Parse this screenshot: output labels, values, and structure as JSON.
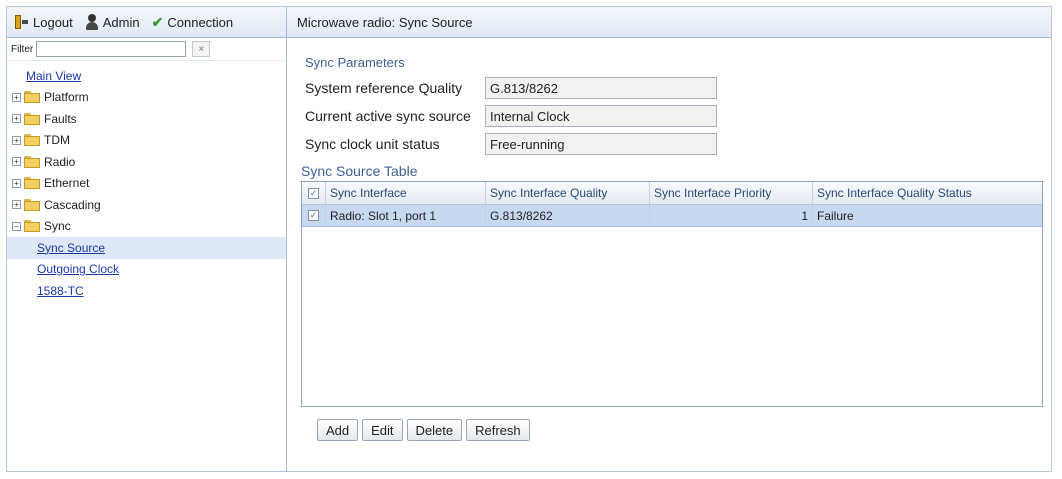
{
  "toolbar": {
    "logout_label": "Logout",
    "admin_label": "Admin",
    "connection_label": "Connection"
  },
  "filter": {
    "label": "Filter",
    "value": "",
    "clear_glyph": "×"
  },
  "tree": {
    "main_view": "Main View",
    "folders": [
      {
        "label": "Platform",
        "toggle": "+"
      },
      {
        "label": "Faults",
        "toggle": "+"
      },
      {
        "label": "TDM",
        "toggle": "+"
      },
      {
        "label": "Radio",
        "toggle": "+"
      },
      {
        "label": "Ethernet",
        "toggle": "+"
      },
      {
        "label": "Cascading",
        "toggle": "+"
      },
      {
        "label": "Sync",
        "toggle": "−"
      }
    ],
    "sync_children": [
      "Sync Source",
      "Outgoing Clock",
      "1588-TC"
    ]
  },
  "panel": {
    "title": "Microwave radio: Sync Source",
    "section_title": "Sync Parameters",
    "params": [
      {
        "label": "System reference Quality",
        "value": "G.813/8262"
      },
      {
        "label": "Current active sync source",
        "value": "Internal Clock"
      },
      {
        "label": "Sync clock unit status",
        "value": "Free-running"
      }
    ],
    "table_title": "Sync Source Table",
    "columns": [
      "Sync Interface",
      "Sync Interface Quality",
      "Sync Interface Priority",
      "Sync Interface Quality Status"
    ],
    "rows": [
      {
        "interface": "Radio: Slot 1, port 1",
        "quality": "G.813/8262",
        "priority": "1",
        "status": "Failure",
        "checked": true
      }
    ],
    "header_checked": true,
    "check_glyph": "✓"
  },
  "buttons": {
    "add": "Add",
    "edit": "Edit",
    "delete": "Delete",
    "refresh": "Refresh"
  },
  "icons": {
    "logout": "logout-door-icon",
    "admin": "admin-user-icon",
    "connection": "checkmark-icon",
    "folder": "folder-icon"
  },
  "colors": {
    "link": "#1a3aa8",
    "section_title": "#3d5f96",
    "selected_row": "#c7d9f1",
    "header_gradient_end": "#dfe8f4"
  }
}
